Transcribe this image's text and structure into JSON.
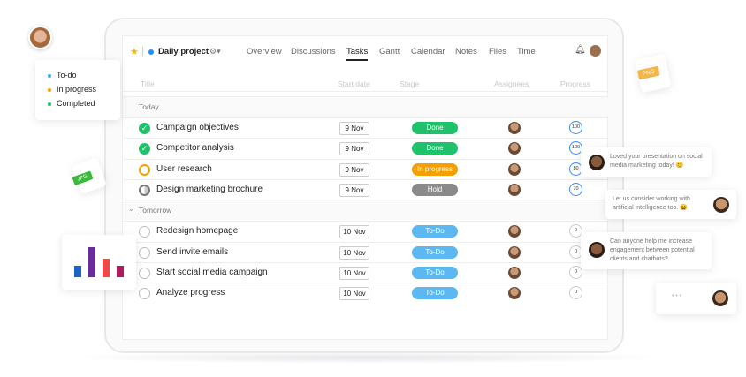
{
  "header": {
    "project": "Daily project",
    "tabs": [
      "Overview",
      "Discussions",
      "Tasks",
      "Gantt",
      "Calendar",
      "Notes",
      "Files",
      "Time"
    ],
    "active_tab": "Tasks"
  },
  "columns": [
    "Title",
    "Start date",
    "Stage",
    "Assignees",
    "Progress"
  ],
  "groups": [
    {
      "label": "Today",
      "tasks": [
        {
          "title": "Campaign objectives",
          "date": "9 Nov",
          "stage": "Done",
          "progress": "100",
          "status": "done"
        },
        {
          "title": "Competitor analysis",
          "date": "9 Nov",
          "stage": "Done",
          "progress": "100",
          "status": "done"
        },
        {
          "title": "User research",
          "date": "9 Nov",
          "stage": "In progress",
          "progress": "80",
          "status": "progress"
        },
        {
          "title": "Design marketing brochure",
          "date": "9 Nov",
          "stage": "Hold",
          "progress": "70",
          "status": "hold"
        }
      ]
    },
    {
      "label": "Tomorrow",
      "tasks": [
        {
          "title": "Redesign homepage",
          "date": "10 Nov",
          "stage": "To-Do",
          "progress": "0",
          "status": "todo"
        },
        {
          "title": "Send invite emails",
          "date": "10 Nov",
          "stage": "To-Do",
          "progress": "0",
          "status": "todo"
        },
        {
          "title": "Start social media campaign",
          "date": "10 Nov",
          "stage": "To-Do",
          "progress": "0",
          "status": "todo"
        },
        {
          "title": "Analyze progress",
          "date": "10 Nov",
          "stage": "To-Do",
          "progress": "0",
          "status": "todo"
        }
      ]
    }
  ],
  "legend": [
    {
      "label": "To-do",
      "color": "#3aa9f0"
    },
    {
      "label": "In progress",
      "color": "#f5a000"
    },
    {
      "label": "Completed",
      "color": "#1fc16b"
    }
  ],
  "files": {
    "jpg": "JPG",
    "png": "PNG"
  },
  "chat": [
    {
      "text": "Loved your presentation on social media marketing today! 😊"
    },
    {
      "text": "Let us consider working with artificial intelligence too. 😀"
    },
    {
      "text": "Can anyone help me increase engagement between potential clients and chatbots?"
    },
    {
      "text": "• • •"
    }
  ],
  "mini_chart": {
    "values": [
      3,
      8,
      5,
      3
    ],
    "colors": [
      "#1a62c8",
      "#6a2c9c",
      "#f24848",
      "#b01a5c"
    ]
  },
  "stage_colors": {
    "done": "#1fc16b",
    "progress": "#f5a000",
    "hold": "#8a8a8a",
    "todo": "#5cb8f0"
  }
}
